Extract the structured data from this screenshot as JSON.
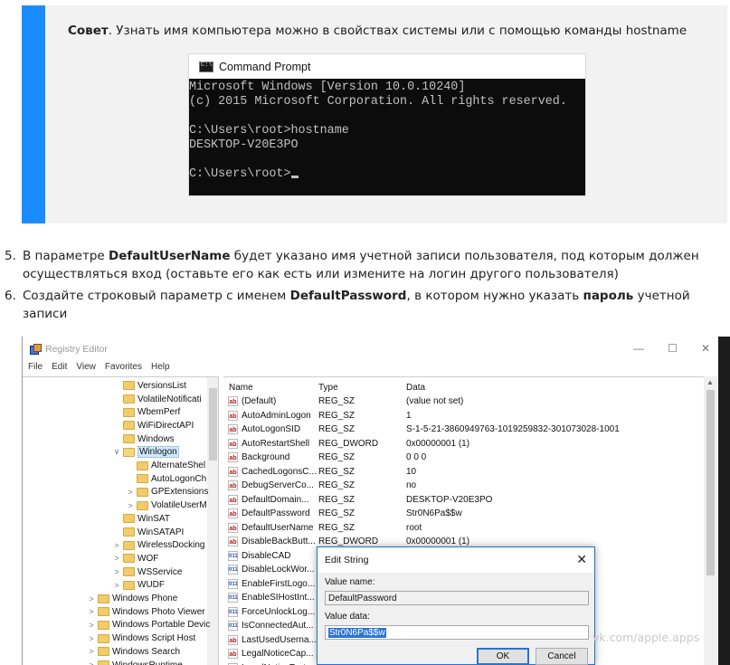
{
  "tip": {
    "bold": "Совет",
    "text": ". Узнать имя компьютера можно в свойствах системы или с помощью команды hostname",
    "cmd": {
      "title": "Command Prompt",
      "lines": [
        "Microsoft Windows [Version 10.0.10240]",
        "(c) 2015 Microsoft Corporation. All rights reserved.",
        "",
        "C:\\Users\\root>hostname",
        "DESKTOP-V20E3PO",
        "",
        "C:\\Users\\root>"
      ]
    }
  },
  "steps": [
    {
      "num": "5.",
      "t1": "В параметре ",
      "b1": "DefaultUserName",
      "t2": " будет указано имя учетной записи пользователя, под которым должен осуществляться вход (оставьте его как есть или измените на логин другого пользователя)",
      "b2": "",
      "t3": ""
    },
    {
      "num": "6.",
      "t1": "Создайте строковый параметр с именем ",
      "b1": "DefaultPassword",
      "t2": ", в котором нужно указать ",
      "b2": "пароль",
      "t3": " учетной записи"
    }
  ],
  "registry": {
    "title": "Registry Editor",
    "window_controls": [
      "—",
      "☐",
      "✕"
    ],
    "menu": [
      "File",
      "Edit",
      "View",
      "Favorites",
      "Help"
    ],
    "tree": [
      {
        "label": "VersionsList",
        "indent": 1,
        "exp": ""
      },
      {
        "label": "VolatileNotificati",
        "indent": 1,
        "exp": ""
      },
      {
        "label": "WbemPerf",
        "indent": 1,
        "exp": ""
      },
      {
        "label": "WiFiDirectAPI",
        "indent": 1,
        "exp": ""
      },
      {
        "label": "Windows",
        "indent": 1,
        "exp": ""
      },
      {
        "label": "Winlogon",
        "indent": 1,
        "exp": "∨",
        "selected": true
      },
      {
        "label": "AlternateShel",
        "indent": 2,
        "exp": ""
      },
      {
        "label": "AutoLogonCh",
        "indent": 2,
        "exp": ""
      },
      {
        "label": "GPExtensions",
        "indent": 2,
        "exp": ">"
      },
      {
        "label": "VolatileUserM",
        "indent": 2,
        "exp": ">"
      },
      {
        "label": "WinSAT",
        "indent": 1,
        "exp": ""
      },
      {
        "label": "WinSATAPI",
        "indent": 1,
        "exp": ""
      },
      {
        "label": "WirelessDocking",
        "indent": 1,
        "exp": ">"
      },
      {
        "label": "WOF",
        "indent": 1,
        "exp": ">"
      },
      {
        "label": "WSService",
        "indent": 1,
        "exp": ">"
      },
      {
        "label": "WUDF",
        "indent": 1,
        "exp": ">"
      },
      {
        "label": "Windows Phone",
        "indent": 0,
        "exp": ">"
      },
      {
        "label": "Windows Photo Viewer",
        "indent": 0,
        "exp": ">"
      },
      {
        "label": "Windows Portable Devic",
        "indent": 0,
        "exp": ">"
      },
      {
        "label": "Windows Script Host",
        "indent": 0,
        "exp": ">"
      },
      {
        "label": "Windows Search",
        "indent": 0,
        "exp": ">"
      },
      {
        "label": "WindowsRuntime",
        "indent": 0,
        "exp": ">"
      }
    ],
    "columns": [
      "Name",
      "Type",
      "Data"
    ],
    "values": [
      {
        "icon": "ab",
        "name": "(Default)",
        "type": "REG_SZ",
        "data": "(value not set)"
      },
      {
        "icon": "ab",
        "name": "AutoAdminLogon",
        "type": "REG_SZ",
        "data": "1"
      },
      {
        "icon": "ab",
        "name": "AutoLogonSID",
        "type": "REG_SZ",
        "data": "S-1-5-21-3860949763-1019259832-301073028-1001"
      },
      {
        "icon": "ab",
        "name": "AutoRestartShell",
        "type": "REG_DWORD",
        "data": "0x00000001 (1)"
      },
      {
        "icon": "ab",
        "name": "Background",
        "type": "REG_SZ",
        "data": "0 0 0"
      },
      {
        "icon": "ab",
        "name": "CachedLogonsC...",
        "type": "REG_SZ",
        "data": "10"
      },
      {
        "icon": "ab",
        "name": "DebugServerCo...",
        "type": "REG_SZ",
        "data": "no"
      },
      {
        "icon": "ab",
        "name": "DefaultDomain...",
        "type": "REG_SZ",
        "data": "DESKTOP-V20E3PO"
      },
      {
        "icon": "ab",
        "name": "DefaultPassword",
        "type": "REG_SZ",
        "data": "Str0N6Pa$$w"
      },
      {
        "icon": "ab",
        "name": "DefaultUserName",
        "type": "REG_SZ",
        "data": "root"
      },
      {
        "icon": "ab",
        "name": "DisableBackButt...",
        "type": "REG_DWORD",
        "data": "0x00000001 (1)"
      },
      {
        "icon": "bin",
        "name": "DisableCAD",
        "type": "",
        "data": ""
      },
      {
        "icon": "bin",
        "name": "DisableLockWor...",
        "type": "",
        "data": ""
      },
      {
        "icon": "bin",
        "name": "EnableFirstLogo...",
        "type": "",
        "data": ""
      },
      {
        "icon": "bin",
        "name": "EnableSIHostInt...",
        "type": "",
        "data": ""
      },
      {
        "icon": "bin",
        "name": "ForceUnlockLog...",
        "type": "",
        "data": ""
      },
      {
        "icon": "bin",
        "name": "IsConnectedAut...",
        "type": "",
        "data": ""
      },
      {
        "icon": "ab",
        "name": "LastUsedUserna...",
        "type": "",
        "data": ""
      },
      {
        "icon": "ab",
        "name": "LegalNoticeCap...",
        "type": "",
        "data": ""
      },
      {
        "icon": "ab",
        "name": "LegalNoticeText",
        "type": "",
        "data": ""
      }
    ]
  },
  "dialog": {
    "title": "Edit String",
    "close": "✕",
    "name_label": "Value name:",
    "name_value": "DefaultPassword",
    "data_label": "Value data:",
    "data_value": "Str0N6Pa$$w",
    "ok": "OK",
    "cancel": "Cancel"
  },
  "watermark": "vk.com/apple.apps"
}
